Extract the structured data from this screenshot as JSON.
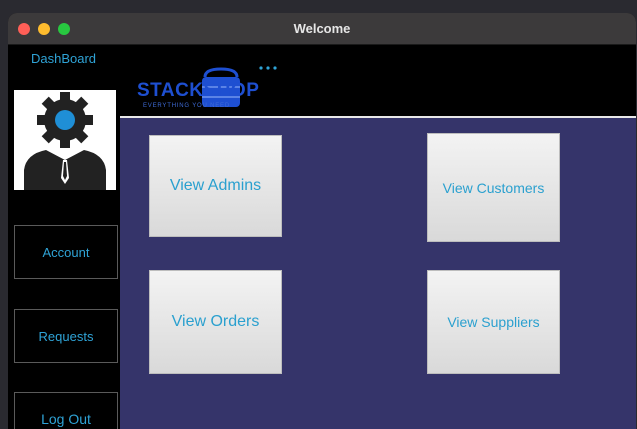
{
  "window": {
    "title": "Welcome"
  },
  "sidebar": {
    "dashboard_label": "DashBoard",
    "account_label": "Account",
    "requests_label": "Requests",
    "logout_label": "Log Out"
  },
  "header": {
    "brand": "STACKSHOP",
    "tagline": "EVERYTHING YOU NEED"
  },
  "tiles": {
    "view_admins": "View Admins",
    "view_customers": "View Customers",
    "view_orders": "View Orders",
    "view_suppliers": "View Suppliers"
  },
  "colors": {
    "accent": "#2fa3d6",
    "content_bg": "#35346a",
    "brand": "#1e4fd1"
  }
}
